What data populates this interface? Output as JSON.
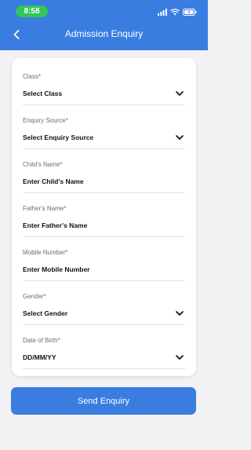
{
  "status_bar": {
    "time": "8:58"
  },
  "header": {
    "title": "Admission Enquiry",
    "back_icon": "chevron-left-icon"
  },
  "form": {
    "fields": [
      {
        "label": "Class*",
        "value": "Select Class",
        "dropdown": true
      },
      {
        "label": "Enquiry Source*",
        "value": "Select Enquiry Source",
        "dropdown": true
      },
      {
        "label": "Child's Name*",
        "value": "Enter Child's Name",
        "dropdown": false
      },
      {
        "label": "Father's Name*",
        "value": "Enter Father's Name",
        "dropdown": false
      },
      {
        "label": "Mobile Number*",
        "value": "Enter Mobile Number",
        "dropdown": false
      },
      {
        "label": "Gender*",
        "value": "Select Gender",
        "dropdown": true
      },
      {
        "label": "Date of Birth*",
        "value": "DD/MM/YY",
        "dropdown": true
      }
    ]
  },
  "actions": {
    "send_label": "Send Enquiry"
  },
  "colors": {
    "primary": "#3a7de0",
    "status_green": "#33c65a",
    "background": "#f2f2f4"
  }
}
